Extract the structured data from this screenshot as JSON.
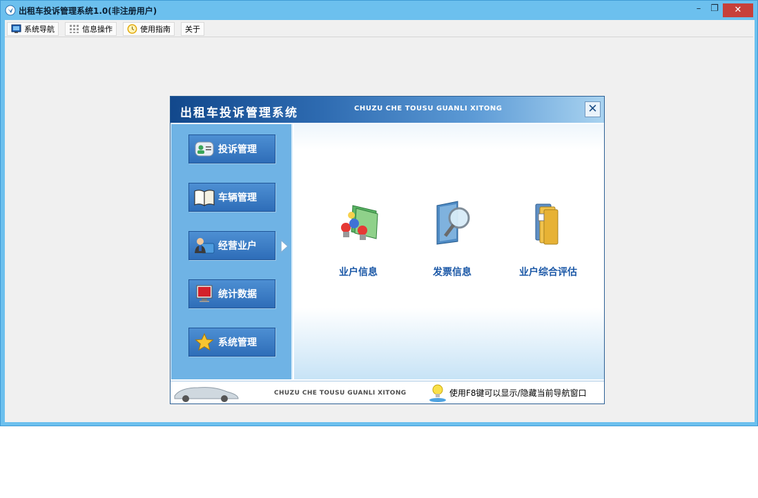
{
  "window": {
    "title": "出租车投诉管理系统1.0(非注册用户)",
    "min_glyph": "–",
    "restore_glyph": "❐",
    "close_glyph": "✕"
  },
  "menu": [
    {
      "label": "系统导航",
      "icon": "monitor-icon"
    },
    {
      "label": "信息操作",
      "icon": "grid-icon"
    },
    {
      "label": "使用指南",
      "icon": "clock-icon"
    },
    {
      "label": "关于",
      "icon": ""
    }
  ],
  "nav": {
    "title": "出租车投诉管理系统",
    "pinyin": "CHUZU CHE TOUSU GUANLI XITONG",
    "close_glyph": "✕",
    "sidebar": [
      {
        "label": "投诉管理",
        "icon": "contact-card-icon"
      },
      {
        "label": "车辆管理",
        "icon": "book-icon"
      },
      {
        "label": "经营业户",
        "icon": "users-icon",
        "active": true
      },
      {
        "label": "统计数据",
        "icon": "monitor-icon"
      },
      {
        "label": "系统管理",
        "icon": "star-icon"
      }
    ],
    "content": [
      {
        "label": "业户信息",
        "icon": "people-folder-icon"
      },
      {
        "label": "发票信息",
        "icon": "magnifier-book-icon"
      },
      {
        "label": "业户综合评估",
        "icon": "folders-icon"
      }
    ],
    "footer": {
      "pinyin": "CHUZU CHE TOUSU GUANLI XITONG",
      "hint": "使用F8键可以显示/隐藏当前导航窗口"
    }
  },
  "colors": {
    "titlebar": "#6cc0ee",
    "close": "#c7403a",
    "sidebar": "#6fb3e5",
    "side_button": "#2e6db8",
    "content_label": "#1a57a6"
  }
}
